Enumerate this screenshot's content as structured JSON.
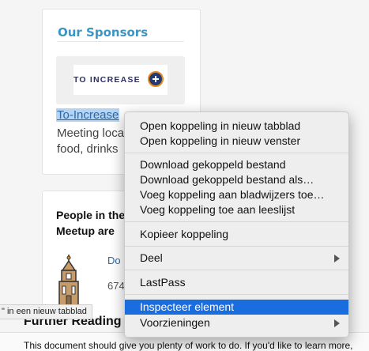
{
  "sponsors": {
    "heading": "Our Sponsors",
    "logo_text": "TO INCREASE",
    "link_text": "To-Increase",
    "description_line1": "Meeting loca",
    "description_line2": "food, drinks"
  },
  "people": {
    "title_line1": "People in the",
    "title_line2": "Meetup are",
    "person_name": "Do",
    "person_number": "674"
  },
  "status_tooltip": "\" in een nieuw tabblad",
  "further_heading": "Further Reading",
  "bottom_text": "This document should give you plenty of work to do. If you'd like to learn more,",
  "context_menu": {
    "items": [
      "Open koppeling in nieuw tabblad",
      "Open koppeling in nieuw venster",
      "Download gekoppeld bestand",
      "Download gekoppeld bestand als…",
      "Voeg koppeling aan bladwijzers toe…",
      "Voeg koppeling toe aan leeslijst",
      "Kopieer koppeling",
      "Deel",
      "LastPass",
      "Inspecteer element",
      "Voorzieningen"
    ]
  },
  "colors": {
    "heading_blue": "#3b95c4",
    "menu_highlight": "#1a6dde",
    "link_blue": "#2a6aa8"
  }
}
